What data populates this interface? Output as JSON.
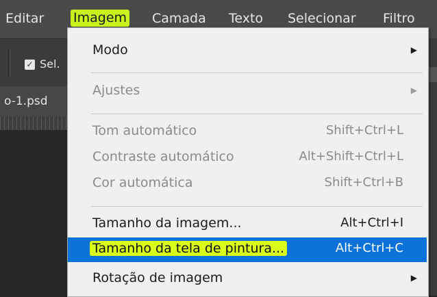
{
  "menubar": {
    "items": [
      {
        "label": "Editar"
      },
      {
        "label": "Imagem",
        "active": true
      },
      {
        "label": "Camada"
      },
      {
        "label": "Texto"
      },
      {
        "label": "Selecionar"
      },
      {
        "label": "Filtro"
      }
    ]
  },
  "options_bar": {
    "checkbox_label": "Sel.",
    "checkbox_checked": true
  },
  "document_tab": {
    "label": "o-1.psd"
  },
  "menu": {
    "items": [
      {
        "label": "Modo",
        "shortcut": "",
        "submenu": true,
        "disabled": false
      },
      {
        "label": "Ajustes",
        "shortcut": "",
        "submenu": true,
        "disabled": true
      },
      {
        "label": "Tom automático",
        "shortcut": "Shift+Ctrl+L",
        "disabled": true
      },
      {
        "label": "Contraste automático",
        "shortcut": "Alt+Shift+Ctrl+L",
        "disabled": true
      },
      {
        "label": "Cor automática",
        "shortcut": "Shift+Ctrl+B",
        "disabled": true
      },
      {
        "label": "Tamanho da imagem...",
        "shortcut": "Alt+Ctrl+I",
        "disabled": false
      },
      {
        "label": "Tamanho da tela de pintura...",
        "shortcut": "Alt+Ctrl+C",
        "disabled": false,
        "highlighted": true
      },
      {
        "label": "Rotação de imagem",
        "shortcut": "",
        "submenu": true,
        "disabled": false
      }
    ]
  },
  "colors": {
    "menubar_bg": "#4a4a4a",
    "active_highlight": "#c9f21c",
    "selection_bg": "#0a72d8",
    "menu_bg": "#f0f0f0"
  }
}
